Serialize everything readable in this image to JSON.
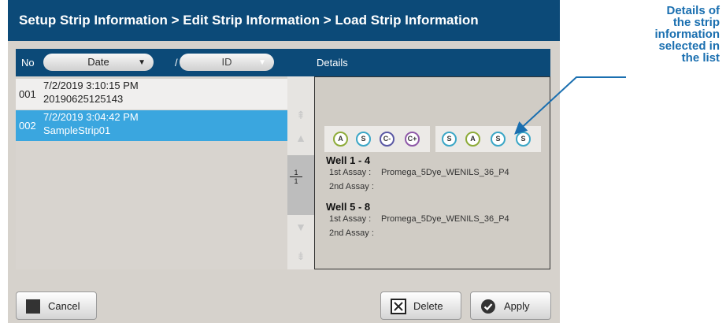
{
  "title": "Setup Strip Information > Edit Strip Information > Load Strip Information",
  "list": {
    "no_header": "No",
    "sort_date": "Date",
    "separator": "/",
    "sort_id": "ID",
    "rows": [
      {
        "no": "001",
        "datetime": "7/2/2019 3:10:15 PM",
        "strip_id": "20190625125143",
        "selected": false
      },
      {
        "no": "002",
        "datetime": "7/2/2019 3:04:42 PM",
        "strip_id": "SampleStrip01",
        "selected": true
      }
    ],
    "page_current": "1",
    "page_total": "1"
  },
  "details": {
    "header": "Details",
    "group1": [
      {
        "label": "A",
        "color": "#8dab38"
      },
      {
        "label": "S",
        "color": "#3aa6c6"
      },
      {
        "label": "C-",
        "color": "#5a58a4"
      },
      {
        "label": "C+",
        "color": "#8e58a8"
      }
    ],
    "group2": [
      {
        "label": "S",
        "color": "#3aa6c6"
      },
      {
        "label": "A",
        "color": "#8dab38"
      },
      {
        "label": "S",
        "color": "#3aa6c6"
      },
      {
        "label": "S",
        "color": "#3aa6c6"
      }
    ],
    "well1_title": "Well 1 - 4",
    "well1_assay1_label": "1st Assay :",
    "well1_assay1_value": "Promega_5Dye_WENILS_36_P4",
    "well1_assay2_label": "2nd Assay :",
    "well2_title": "Well 5 - 8",
    "well2_assay1_label": "1st Assay :",
    "well2_assay1_value": "Promega_5Dye_WENILS_36_P4",
    "well2_assay2_label": "2nd Assay :"
  },
  "buttons": {
    "cancel": "Cancel",
    "delete": "Delete",
    "apply": "Apply"
  },
  "annotation": [
    "Details of",
    "the strip",
    "information",
    "selected in",
    "the list"
  ],
  "colors": {
    "header_blue": "#0c4a78",
    "selected_row": "#3aa6df",
    "annotation_blue": "#1a6fb0"
  }
}
